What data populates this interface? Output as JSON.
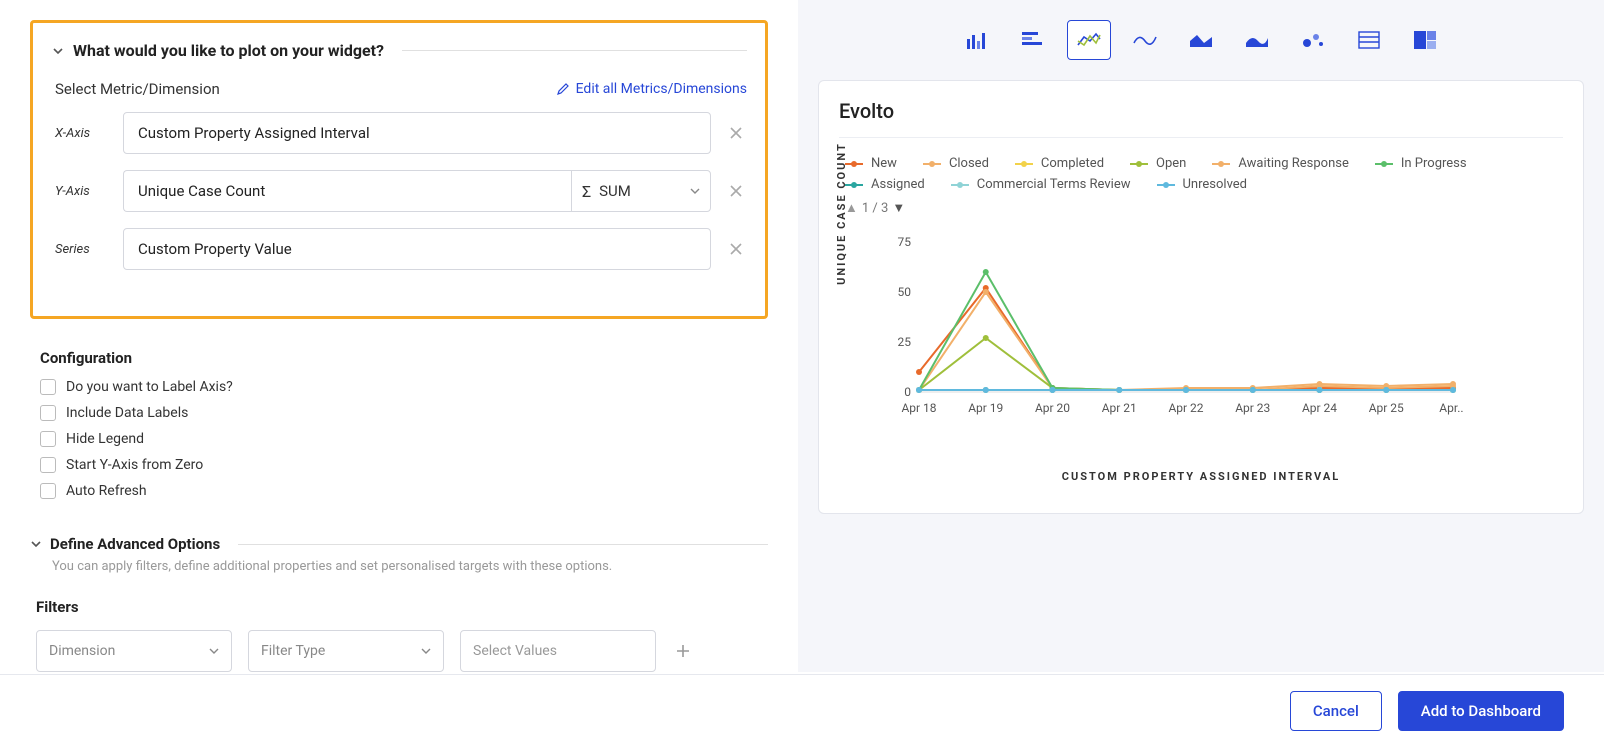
{
  "plot_section": {
    "title": "What would you like to plot on your widget?",
    "select_label": "Select Metric/Dimension",
    "edit_link": "Edit all Metrics/Dimensions",
    "x_label": "X-Axis",
    "x_value": "Custom Property Assigned Interval",
    "y_label": "Y-Axis",
    "y_value": "Unique Case Count",
    "y_agg": "SUM",
    "series_label": "Series",
    "series_value": "Custom Property Value"
  },
  "config": {
    "title": "Configuration",
    "opts": [
      "Do you want to Label Axis?",
      "Include Data Labels",
      "Hide Legend",
      "Start Y-Axis from Zero",
      "Auto Refresh"
    ]
  },
  "adv": {
    "title": "Define Advanced Options",
    "desc": "You can apply filters, define additional properties and set personalised targets with these options.",
    "filters_title": "Filters",
    "dimension_ph": "Dimension",
    "filtertype_ph": "Filter Type",
    "values_ph": "Select Values"
  },
  "preview": {
    "title": "Evolto",
    "pager": "1 / 3",
    "legend": [
      {
        "name": "New",
        "color": "#e86a2b"
      },
      {
        "name": "Closed",
        "color": "#f2b06a"
      },
      {
        "name": "Completed",
        "color": "#f2d24a"
      },
      {
        "name": "Open",
        "color": "#9fbf3b"
      },
      {
        "name": "Awaiting Response",
        "color": "#f2b06a"
      },
      {
        "name": "In Progress",
        "color": "#5bbf6a"
      },
      {
        "name": "Assigned",
        "color": "#2aa6a0"
      },
      {
        "name": "Commercial Terms Review",
        "color": "#8fd3d6"
      },
      {
        "name": "Unresolved",
        "color": "#5fb9de"
      }
    ]
  },
  "footer": {
    "cancel": "Cancel",
    "add": "Add to Dashboard"
  },
  "chart_data": {
    "type": "line",
    "title": "Evolto",
    "xlabel": "CUSTOM PROPERTY ASSIGNED INTERVAL",
    "ylabel": "UNIQUE CASE COUNT",
    "ylim": [
      0,
      80
    ],
    "yticks": [
      0,
      25,
      50,
      75
    ],
    "categories": [
      "Apr 18",
      "Apr 19",
      "Apr 20",
      "Apr 21",
      "Apr 22",
      "Apr 23",
      "Apr 24",
      "Apr 25",
      "Apr..."
    ],
    "series": [
      {
        "name": "New",
        "color": "#e86a2b",
        "values": [
          10,
          52,
          2,
          1,
          1,
          1,
          2,
          2,
          2
        ]
      },
      {
        "name": "Closed",
        "color": "#f2b06a",
        "values": [
          1,
          50,
          2,
          1,
          2,
          2,
          4,
          3,
          4
        ]
      },
      {
        "name": "Completed",
        "color": "#f2d24a",
        "values": [
          1,
          1,
          1,
          1,
          1,
          1,
          1,
          1,
          1
        ]
      },
      {
        "name": "Open",
        "color": "#9fbf3b",
        "values": [
          1,
          27,
          2,
          1,
          1,
          1,
          1,
          1,
          1
        ]
      },
      {
        "name": "Awaiting Response",
        "color": "#f2b06a",
        "values": [
          1,
          1,
          1,
          1,
          1,
          1,
          3,
          2,
          3
        ]
      },
      {
        "name": "In Progress",
        "color": "#5bbf6a",
        "values": [
          1,
          60,
          2,
          1,
          1,
          1,
          1,
          1,
          1
        ]
      },
      {
        "name": "Assigned",
        "color": "#2aa6a0",
        "values": [
          1,
          1,
          1,
          1,
          1,
          1,
          1,
          1,
          1
        ]
      },
      {
        "name": "Commercial Terms Review",
        "color": "#8fd3d6",
        "values": [
          1,
          1,
          1,
          1,
          1,
          1,
          1,
          1,
          1
        ]
      },
      {
        "name": "Unresolved",
        "color": "#5fb9de",
        "values": [
          1,
          1,
          1,
          1,
          1,
          1,
          1,
          1,
          1
        ]
      }
    ]
  }
}
